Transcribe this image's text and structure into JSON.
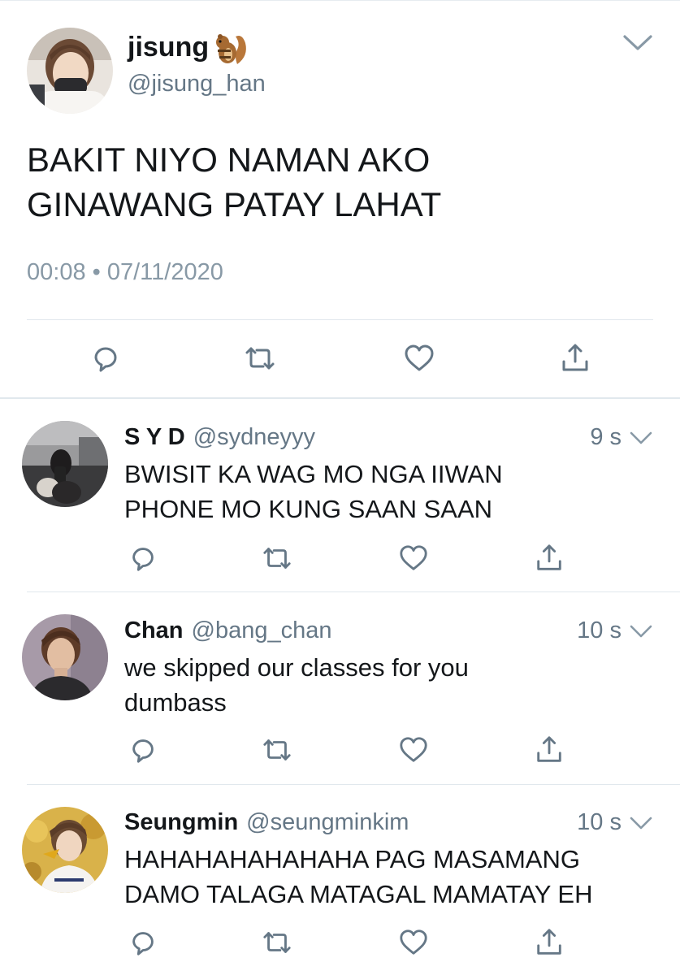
{
  "main_tweet": {
    "display_name": "jisung",
    "name_emoji": "chipmunk-emoji",
    "handle": "@jisung_han",
    "text_lines": [
      "BAKIT NIYO NAMAN AKO",
      "GINAWANG PATAY LAHAT"
    ],
    "time": "00:08",
    "separator": "•",
    "date": "07/11/2020",
    "actions": [
      "reply-icon",
      "retweet-icon",
      "like-icon",
      "share-icon"
    ]
  },
  "replies": [
    {
      "display_name": "S Y D",
      "handle": "@sydneyyy",
      "time": "9 s",
      "text_lines": [
        "BWISIT KA WAG MO NGA IIWAN",
        "PHONE MO KUNG SAAN SAAN"
      ]
    },
    {
      "display_name": "Chan",
      "handle": "@bang_chan",
      "time": "10 s",
      "text_lines": [
        "we skipped our classes for you",
        "dumbass"
      ]
    },
    {
      "display_name": "Seungmin",
      "handle": "@seungminkim",
      "time": "10 s",
      "text_lines": [
        "HAHAHAHAHAHAHA PAG MASAMANG",
        "DAMO TALAGA MATAGAL MAMATAY EH"
      ]
    }
  ],
  "colors": {
    "text": "#14171a",
    "secondary": "#657786",
    "timestamp": "#8899a6",
    "icon": "#657786",
    "divider": "#e1e8ed"
  }
}
